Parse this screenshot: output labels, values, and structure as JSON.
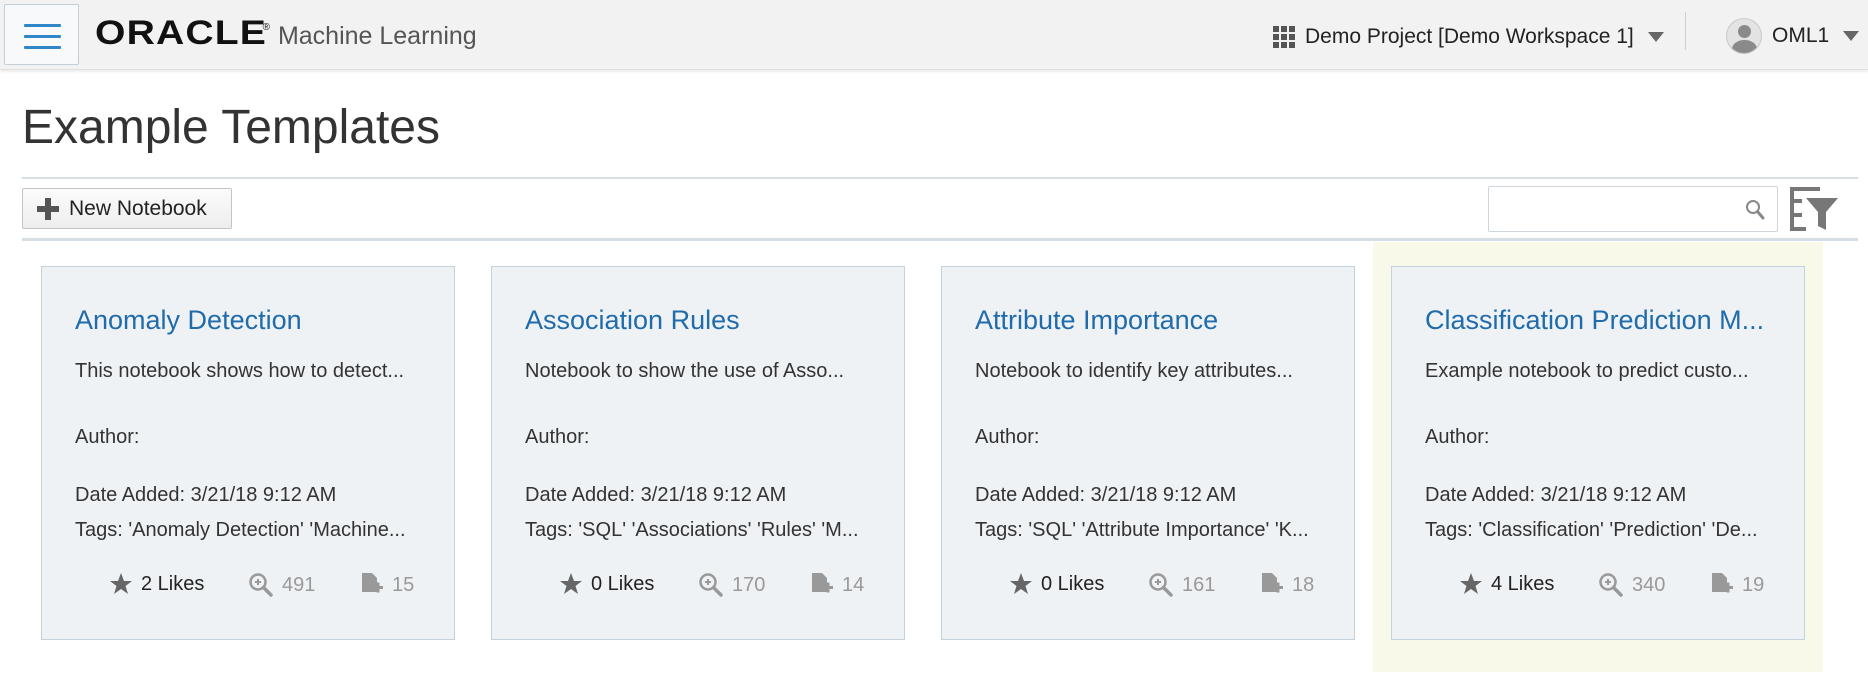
{
  "header": {
    "logo_brand": "ORACLE",
    "logo_product": "Machine Learning",
    "workspace_label": "Demo Project [Demo Workspace 1]",
    "user_name": "OML1"
  },
  "page": {
    "title": "Example Templates"
  },
  "toolbar": {
    "new_notebook_label": "New Notebook",
    "search_placeholder": "",
    "search_value": ""
  },
  "cards": [
    {
      "title": "Anomaly Detection",
      "description": "This notebook shows how to detect...",
      "author": "Author:",
      "date_added": "Date Added: 3/21/18 9:12 AM",
      "tags": "Tags: 'Anomaly Detection' 'Machine...",
      "likes": "2 Likes",
      "views": "491",
      "copies": "15"
    },
    {
      "title": "Association Rules",
      "description": "Notebook to show the use of Asso...",
      "author": "Author:",
      "date_added": "Date Added: 3/21/18 9:12 AM",
      "tags": "Tags: 'SQL' 'Associations' 'Rules' 'M...",
      "likes": "0 Likes",
      "views": "170",
      "copies": "14"
    },
    {
      "title": "Attribute Importance",
      "description": "Notebook to identify key attributes...",
      "author": "Author:",
      "date_added": "Date Added: 3/21/18 9:12 AM",
      "tags": "Tags: 'SQL' 'Attribute Importance' 'K...",
      "likes": "0 Likes",
      "views": "161",
      "copies": "18"
    },
    {
      "title": "Classification Prediction M...",
      "description": "Example notebook to predict custo...",
      "author": "Author:",
      "date_added": "Date Added: 3/21/18 9:12 AM",
      "tags": "Tags: 'Classification' 'Prediction' 'De...",
      "likes": "4 Likes",
      "views": "340",
      "copies": "19"
    }
  ],
  "colors": {
    "accent_link": "#1f6bab",
    "menu_blue": "#2f86c9",
    "card_bg": "#eef2f5",
    "highlight_bg": "#f8f9e8"
  },
  "icons": [
    "hamburger-menu-icon",
    "grid-icon",
    "chevron-down-icon",
    "avatar",
    "plus-icon",
    "search-icon",
    "filter-icon",
    "star-icon",
    "magnifier-icon",
    "copy-document-icon"
  ]
}
